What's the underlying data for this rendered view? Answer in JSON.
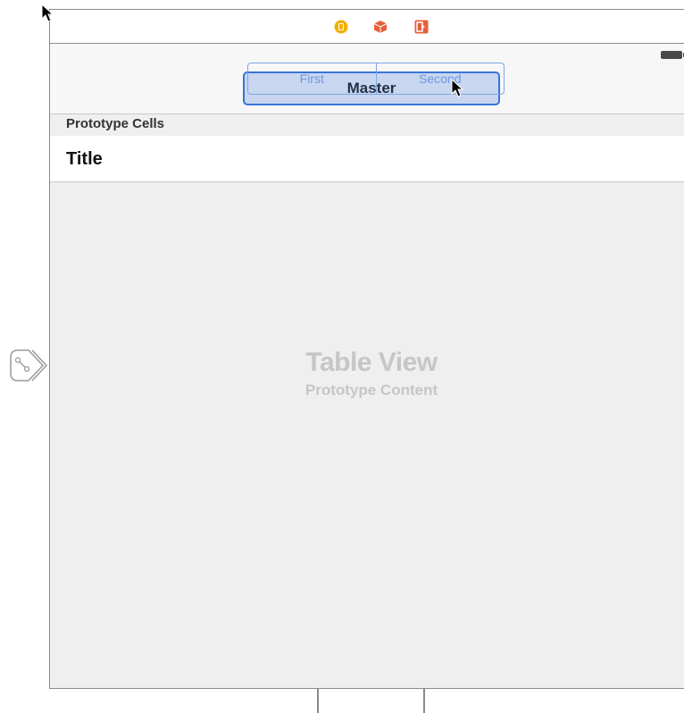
{
  "scene_dock": {
    "icons": [
      "view-controller-icon",
      "first-responder-icon",
      "exit-icon"
    ],
    "colors": {
      "view_controller": "#f2b000",
      "first_responder": "#e8603a",
      "exit": "#e8603a"
    }
  },
  "navigation_bar": {
    "title": "Master"
  },
  "segmented_control": {
    "segments": [
      "First",
      "Second"
    ]
  },
  "table": {
    "section_header": "Prototype Cells",
    "cell_title": "Title",
    "placeholder_title": "Table View",
    "placeholder_subtitle": "Prototype Content"
  },
  "colors": {
    "selection_blue": "#3a74d8",
    "placeholder_text": "#c6c6c6",
    "table_background": "#efefef"
  }
}
